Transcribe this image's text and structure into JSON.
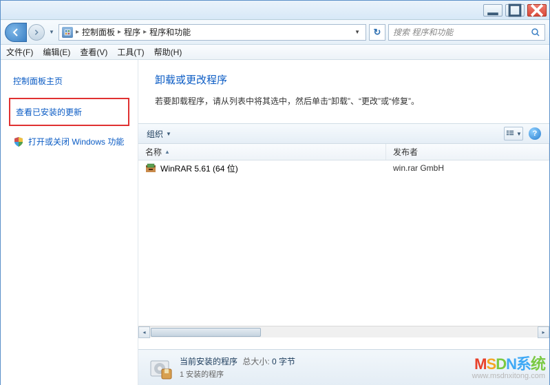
{
  "window": {
    "min_tip": "最小化",
    "max_tip": "最大化",
    "close_tip": "关闭"
  },
  "breadcrumb": {
    "root": "控制面板",
    "level1": "程序",
    "level2": "程序和功能"
  },
  "search": {
    "placeholder": "搜索 程序和功能"
  },
  "menu": {
    "file": "文件(F)",
    "edit": "编辑(E)",
    "view": "查看(V)",
    "tools": "工具(T)",
    "help": "帮助(H)"
  },
  "sidebar": {
    "home": "控制面板主页",
    "updates": "查看已安装的更新",
    "features": "打开或关闭 Windows 功能"
  },
  "page": {
    "title": "卸载或更改程序",
    "desc": "若要卸载程序，请从列表中将其选中，然后单击“卸载”、“更改”或“修复”。"
  },
  "toolbar": {
    "organize": "组织"
  },
  "columns": {
    "name": "名称",
    "publisher": "发布者"
  },
  "rows": [
    {
      "name": "WinRAR 5.61 (64 位)",
      "publisher": "win.rar GmbH"
    }
  ],
  "status": {
    "label": "当前安装的程序",
    "size_label": "总大小:",
    "size_value": "0 字节",
    "count": "1 安装的程序"
  },
  "watermark": {
    "brand": "MSDN系统",
    "url": "www.msdnxitong.com"
  }
}
